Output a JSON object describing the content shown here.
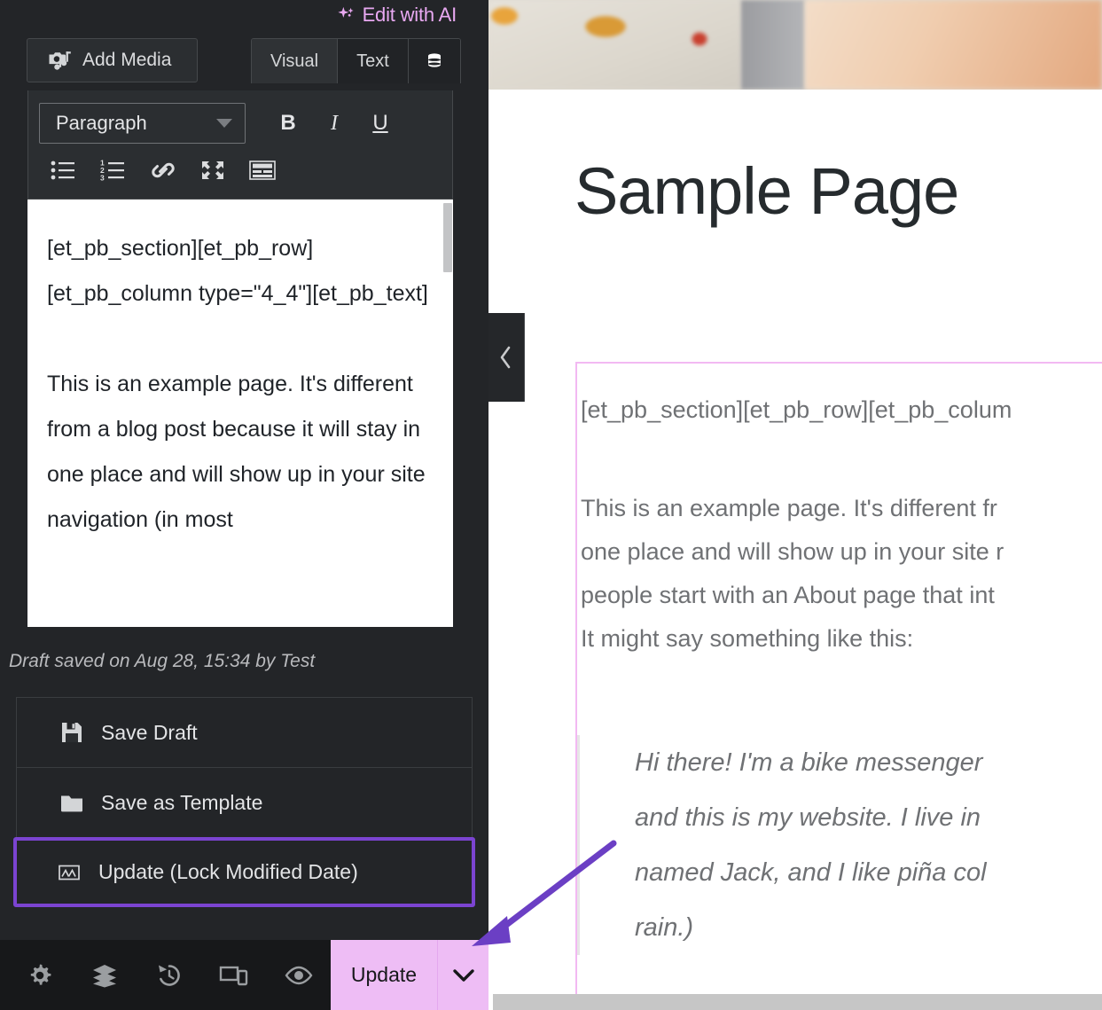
{
  "editor": {
    "ai_button": {
      "label": "Edit with AI",
      "icon": "sparkle-icon",
      "color": "#e9a9f2"
    },
    "add_media": {
      "label": "Add Media",
      "icon": "media-camera-music-icon"
    },
    "tabs": [
      {
        "label": "Visual",
        "active": true
      },
      {
        "label": "Text",
        "active": false
      }
    ],
    "database_tab_icon": "database-stack-icon",
    "format_bar": {
      "paragraph_select": {
        "value": "Paragraph",
        "caret_icon": "caret-down-icon"
      },
      "bold_label": "B",
      "italic_label": "I",
      "underline_label": "U",
      "icons": [
        "bullet-list-icon",
        "numbered-list-icon",
        "link-icon",
        "fullscreen-icon",
        "keyboard-toolbar-icon"
      ]
    },
    "content": {
      "shortcodes": "[et_pb_section][et_pb_row][et_pb_column type=\"4_4\"][et_pb_text]",
      "paragraph": "This is an example page. It's different from a blog post because it will stay in one place and will show up in your site navigation (in most"
    },
    "draft_note": "Draft saved on Aug 28, 15:34 by Test",
    "actions": [
      {
        "label": "Save Draft",
        "icon": "floppy-disk-icon",
        "highlighted": false
      },
      {
        "label": "Save as Template",
        "icon": "folder-icon",
        "highlighted": false
      },
      {
        "label": "Update (Lock Modified Date)",
        "icon": "lock-date-icon",
        "highlighted": true
      }
    ],
    "highlight_color": "#7b44d1",
    "bottom_bar": {
      "icons": [
        "gear-icon",
        "layers-icon",
        "history-icon",
        "responsive-devices-icon",
        "eye-preview-icon"
      ],
      "update_label": "Update",
      "update_chevron_icon": "chevron-down-icon",
      "update_bg": "#eebdf5"
    }
  },
  "preview": {
    "collapse_icon": "chevron-left-icon",
    "page_title": "Sample Page",
    "content_border_color": "#f2b9f2",
    "shortcode_line": "[et_pb_section][et_pb_row][et_pb_colum",
    "paragraph_lines": [
      "This is an example page. It's different fr",
      "one place and will show up in your site r",
      "people start with an About page that int",
      "It might say something like this:"
    ],
    "quote_lines": [
      "Hi there! I'm a bike messenger",
      "and this is my website. I live in",
      "named Jack, and I like piña col",
      "rain.)"
    ]
  },
  "annotation": {
    "type": "arrow",
    "color": "#6b3fc4",
    "points_to": "update-chevron"
  }
}
